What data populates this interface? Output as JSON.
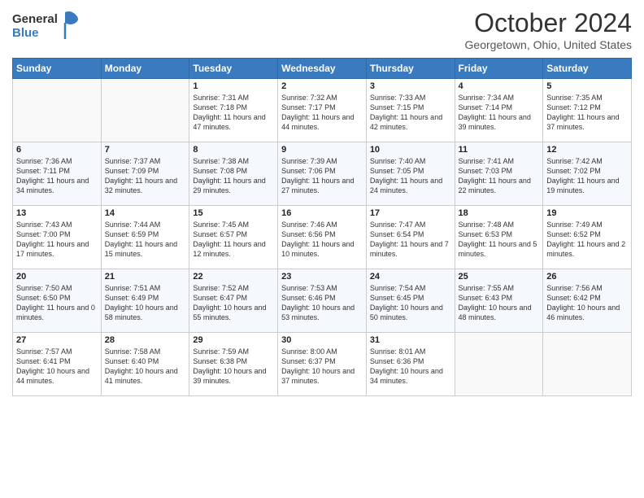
{
  "header": {
    "logo_general": "General",
    "logo_blue": "Blue",
    "title": "October 2024",
    "subtitle": "Georgetown, Ohio, United States"
  },
  "days_of_week": [
    "Sunday",
    "Monday",
    "Tuesday",
    "Wednesday",
    "Thursday",
    "Friday",
    "Saturday"
  ],
  "weeks": [
    [
      {
        "day": "",
        "sunrise": "",
        "sunset": "",
        "daylight": ""
      },
      {
        "day": "",
        "sunrise": "",
        "sunset": "",
        "daylight": ""
      },
      {
        "day": "1",
        "sunrise": "Sunrise: 7:31 AM",
        "sunset": "Sunset: 7:18 PM",
        "daylight": "Daylight: 11 hours and 47 minutes."
      },
      {
        "day": "2",
        "sunrise": "Sunrise: 7:32 AM",
        "sunset": "Sunset: 7:17 PM",
        "daylight": "Daylight: 11 hours and 44 minutes."
      },
      {
        "day": "3",
        "sunrise": "Sunrise: 7:33 AM",
        "sunset": "Sunset: 7:15 PM",
        "daylight": "Daylight: 11 hours and 42 minutes."
      },
      {
        "day": "4",
        "sunrise": "Sunrise: 7:34 AM",
        "sunset": "Sunset: 7:14 PM",
        "daylight": "Daylight: 11 hours and 39 minutes."
      },
      {
        "day": "5",
        "sunrise": "Sunrise: 7:35 AM",
        "sunset": "Sunset: 7:12 PM",
        "daylight": "Daylight: 11 hours and 37 minutes."
      }
    ],
    [
      {
        "day": "6",
        "sunrise": "Sunrise: 7:36 AM",
        "sunset": "Sunset: 7:11 PM",
        "daylight": "Daylight: 11 hours and 34 minutes."
      },
      {
        "day": "7",
        "sunrise": "Sunrise: 7:37 AM",
        "sunset": "Sunset: 7:09 PM",
        "daylight": "Daylight: 11 hours and 32 minutes."
      },
      {
        "day": "8",
        "sunrise": "Sunrise: 7:38 AM",
        "sunset": "Sunset: 7:08 PM",
        "daylight": "Daylight: 11 hours and 29 minutes."
      },
      {
        "day": "9",
        "sunrise": "Sunrise: 7:39 AM",
        "sunset": "Sunset: 7:06 PM",
        "daylight": "Daylight: 11 hours and 27 minutes."
      },
      {
        "day": "10",
        "sunrise": "Sunrise: 7:40 AM",
        "sunset": "Sunset: 7:05 PM",
        "daylight": "Daylight: 11 hours and 24 minutes."
      },
      {
        "day": "11",
        "sunrise": "Sunrise: 7:41 AM",
        "sunset": "Sunset: 7:03 PM",
        "daylight": "Daylight: 11 hours and 22 minutes."
      },
      {
        "day": "12",
        "sunrise": "Sunrise: 7:42 AM",
        "sunset": "Sunset: 7:02 PM",
        "daylight": "Daylight: 11 hours and 19 minutes."
      }
    ],
    [
      {
        "day": "13",
        "sunrise": "Sunrise: 7:43 AM",
        "sunset": "Sunset: 7:00 PM",
        "daylight": "Daylight: 11 hours and 17 minutes."
      },
      {
        "day": "14",
        "sunrise": "Sunrise: 7:44 AM",
        "sunset": "Sunset: 6:59 PM",
        "daylight": "Daylight: 11 hours and 15 minutes."
      },
      {
        "day": "15",
        "sunrise": "Sunrise: 7:45 AM",
        "sunset": "Sunset: 6:57 PM",
        "daylight": "Daylight: 11 hours and 12 minutes."
      },
      {
        "day": "16",
        "sunrise": "Sunrise: 7:46 AM",
        "sunset": "Sunset: 6:56 PM",
        "daylight": "Daylight: 11 hours and 10 minutes."
      },
      {
        "day": "17",
        "sunrise": "Sunrise: 7:47 AM",
        "sunset": "Sunset: 6:54 PM",
        "daylight": "Daylight: 11 hours and 7 minutes."
      },
      {
        "day": "18",
        "sunrise": "Sunrise: 7:48 AM",
        "sunset": "Sunset: 6:53 PM",
        "daylight": "Daylight: 11 hours and 5 minutes."
      },
      {
        "day": "19",
        "sunrise": "Sunrise: 7:49 AM",
        "sunset": "Sunset: 6:52 PM",
        "daylight": "Daylight: 11 hours and 2 minutes."
      }
    ],
    [
      {
        "day": "20",
        "sunrise": "Sunrise: 7:50 AM",
        "sunset": "Sunset: 6:50 PM",
        "daylight": "Daylight: 11 hours and 0 minutes."
      },
      {
        "day": "21",
        "sunrise": "Sunrise: 7:51 AM",
        "sunset": "Sunset: 6:49 PM",
        "daylight": "Daylight: 10 hours and 58 minutes."
      },
      {
        "day": "22",
        "sunrise": "Sunrise: 7:52 AM",
        "sunset": "Sunset: 6:47 PM",
        "daylight": "Daylight: 10 hours and 55 minutes."
      },
      {
        "day": "23",
        "sunrise": "Sunrise: 7:53 AM",
        "sunset": "Sunset: 6:46 PM",
        "daylight": "Daylight: 10 hours and 53 minutes."
      },
      {
        "day": "24",
        "sunrise": "Sunrise: 7:54 AM",
        "sunset": "Sunset: 6:45 PM",
        "daylight": "Daylight: 10 hours and 50 minutes."
      },
      {
        "day": "25",
        "sunrise": "Sunrise: 7:55 AM",
        "sunset": "Sunset: 6:43 PM",
        "daylight": "Daylight: 10 hours and 48 minutes."
      },
      {
        "day": "26",
        "sunrise": "Sunrise: 7:56 AM",
        "sunset": "Sunset: 6:42 PM",
        "daylight": "Daylight: 10 hours and 46 minutes."
      }
    ],
    [
      {
        "day": "27",
        "sunrise": "Sunrise: 7:57 AM",
        "sunset": "Sunset: 6:41 PM",
        "daylight": "Daylight: 10 hours and 44 minutes."
      },
      {
        "day": "28",
        "sunrise": "Sunrise: 7:58 AM",
        "sunset": "Sunset: 6:40 PM",
        "daylight": "Daylight: 10 hours and 41 minutes."
      },
      {
        "day": "29",
        "sunrise": "Sunrise: 7:59 AM",
        "sunset": "Sunset: 6:38 PM",
        "daylight": "Daylight: 10 hours and 39 minutes."
      },
      {
        "day": "30",
        "sunrise": "Sunrise: 8:00 AM",
        "sunset": "Sunset: 6:37 PM",
        "daylight": "Daylight: 10 hours and 37 minutes."
      },
      {
        "day": "31",
        "sunrise": "Sunrise: 8:01 AM",
        "sunset": "Sunset: 6:36 PM",
        "daylight": "Daylight: 10 hours and 34 minutes."
      },
      {
        "day": "",
        "sunrise": "",
        "sunset": "",
        "daylight": ""
      },
      {
        "day": "",
        "sunrise": "",
        "sunset": "",
        "daylight": ""
      }
    ]
  ]
}
